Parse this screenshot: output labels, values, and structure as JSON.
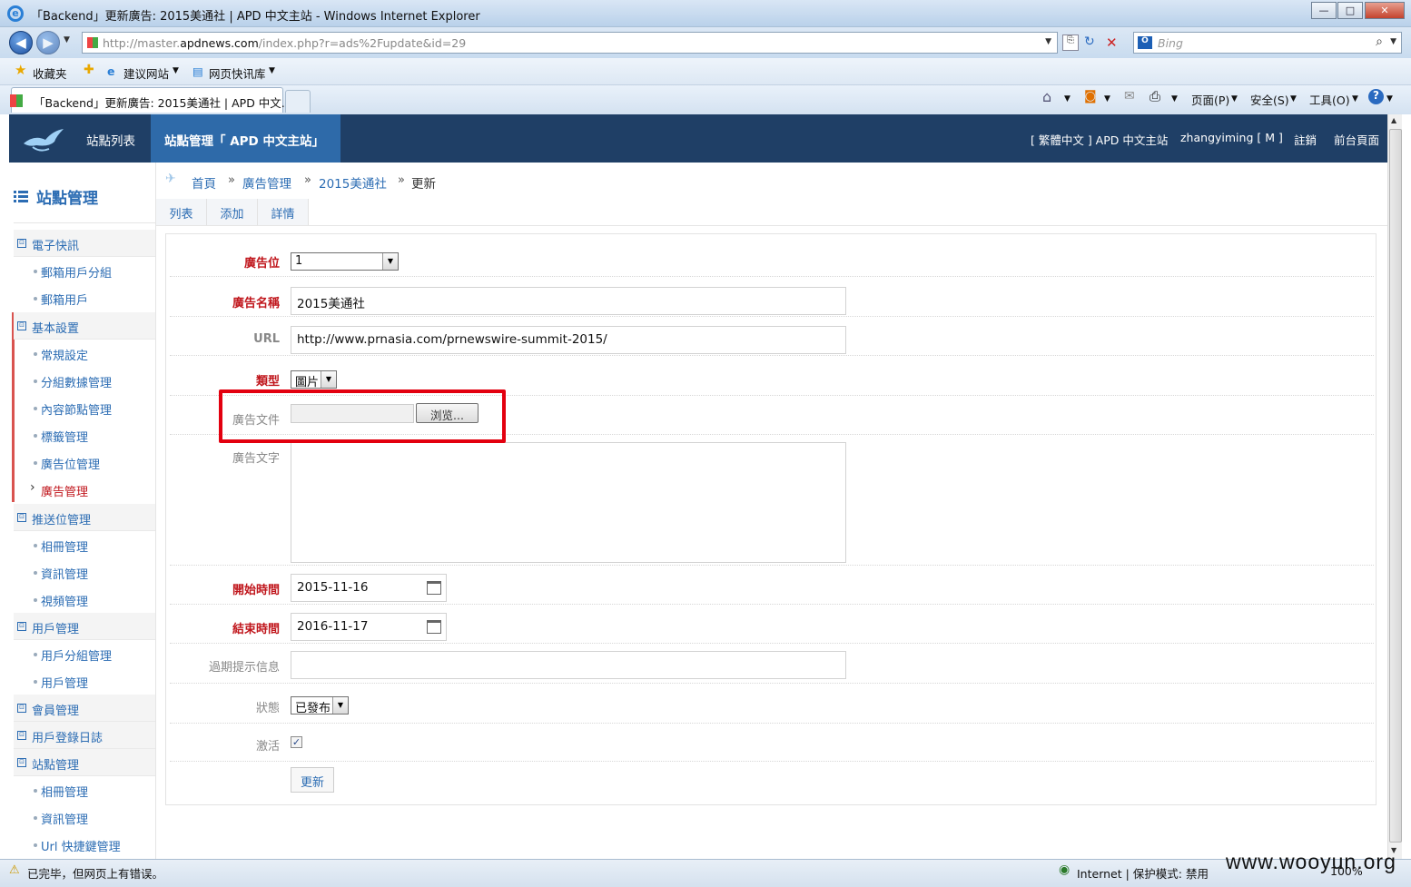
{
  "window": {
    "title": "「Backend」更新廣告: 2015美通社 | APD 中文主站 - Windows Internet Explorer",
    "min": "—",
    "max": "□",
    "close": "✕"
  },
  "address": {
    "prefix": "http://master.",
    "domain": "apdnews.com",
    "path": "/index.php?r=ads%2Fupdate&id=29",
    "search_placeholder": "Bing"
  },
  "favorites": {
    "fav_label": "收藏夹",
    "items": [
      "建议网站",
      "网页快讯库"
    ]
  },
  "tab": {
    "title": "「Backend」更新廣告: 2015美通社 | APD 中文..."
  },
  "commands": {
    "page": "页面(P)",
    "safety": "安全(S)",
    "tools": "工具(O)"
  },
  "header": {
    "links": [
      "站點列表",
      "站點管理「 APD 中文主站」"
    ],
    "right": [
      "[ 繁體中文 ] APD 中文主站",
      "zhangyiming [ M ]",
      "註銷",
      "前台頁面"
    ]
  },
  "sidebar": {
    "title": "站點管理",
    "groups": [
      {
        "label": "電子快訊",
        "items": [
          "郵箱用戶分組",
          "郵箱用戶"
        ]
      },
      {
        "label": "基本設置",
        "items": [
          "常規設定",
          "分組數據管理",
          "內容節點管理",
          "標籤管理",
          "廣告位管理",
          "廣告管理"
        ]
      },
      {
        "label": "推送位管理",
        "items": [
          "相冊管理",
          "資訊管理",
          "視頻管理"
        ]
      },
      {
        "label": "用戶管理",
        "items": [
          "用戶分組管理",
          "用戶管理"
        ]
      },
      {
        "label": "會員管理",
        "items": []
      },
      {
        "label": "用戶登錄日誌",
        "items": []
      },
      {
        "label": "站點管理",
        "items": [
          "相冊管理",
          "資訊管理",
          "Url 快捷鍵管理"
        ]
      }
    ]
  },
  "breadcrumb": {
    "items": [
      "首頁",
      "廣告管理",
      "2015美通社",
      "更新"
    ],
    "sep": "»"
  },
  "subtabs": [
    "列表",
    "添加",
    "詳情"
  ],
  "form": {
    "slot": {
      "label": "廣告位",
      "value": "1"
    },
    "name": {
      "label": "廣告名稱",
      "value": "2015美通社"
    },
    "url": {
      "label": "URL",
      "value": "http://www.prnasia.com/prnewswire-summit-2015/"
    },
    "type": {
      "label": "類型",
      "value": "圖片"
    },
    "file": {
      "label": "廣告文件",
      "browse": "浏览..."
    },
    "text": {
      "label": "廣告文字",
      "value": ""
    },
    "start": {
      "label": "開始時間",
      "value": "2015-11-16"
    },
    "end": {
      "label": "結束時間",
      "value": "2016-11-17"
    },
    "expire": {
      "label": "過期提示信息",
      "value": ""
    },
    "status": {
      "label": "狀態",
      "value": "已發布"
    },
    "active": {
      "label": "激活",
      "checked": true
    },
    "submit": "更新"
  },
  "statusbar": {
    "left": "已完毕，但网页上有错误。",
    "zone": "Internet | 保护模式: 禁用",
    "zoom": "100%"
  },
  "watermark": "www.wooyun.org"
}
